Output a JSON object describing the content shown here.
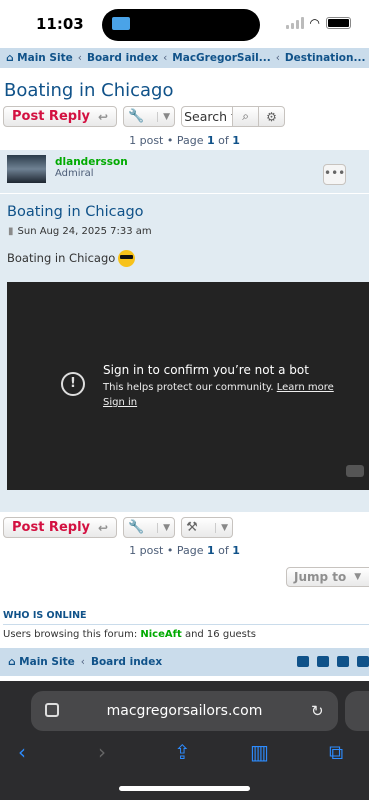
{
  "status": {
    "time": "11:03"
  },
  "breadcrumbs": [
    "Main Site",
    "Board index",
    "MacGregorSail...",
    "Destination..."
  ],
  "page": {
    "title": "Boating in Chicago",
    "post_reply": "Post Reply",
    "search_placeholder": "Search t",
    "pagination": {
      "prefix": "1 post • Page ",
      "current": "1",
      "of": " of ",
      "total": "1"
    }
  },
  "post": {
    "username": "dlandersson",
    "rank": "Admiral",
    "title": "Boating in Chicago",
    "date": "Sun Aug 24, 2025 7:33 am",
    "text": "Boating in Chicago",
    "video": {
      "heading": "Sign in to confirm you’re not a bot",
      "body": "This helps protect our community. ",
      "learn_more": "Learn more",
      "sign_in": "Sign in"
    }
  },
  "jump": {
    "label": "Jump to"
  },
  "online": {
    "title": "WHO IS ONLINE",
    "prefix": "Users browsing this forum: ",
    "user": "NiceAft",
    "suffix": " and 16 guests"
  },
  "footer": {
    "main": "Main Site",
    "board": "Board index"
  },
  "browser": {
    "url": "macgregorsailors.com"
  }
}
